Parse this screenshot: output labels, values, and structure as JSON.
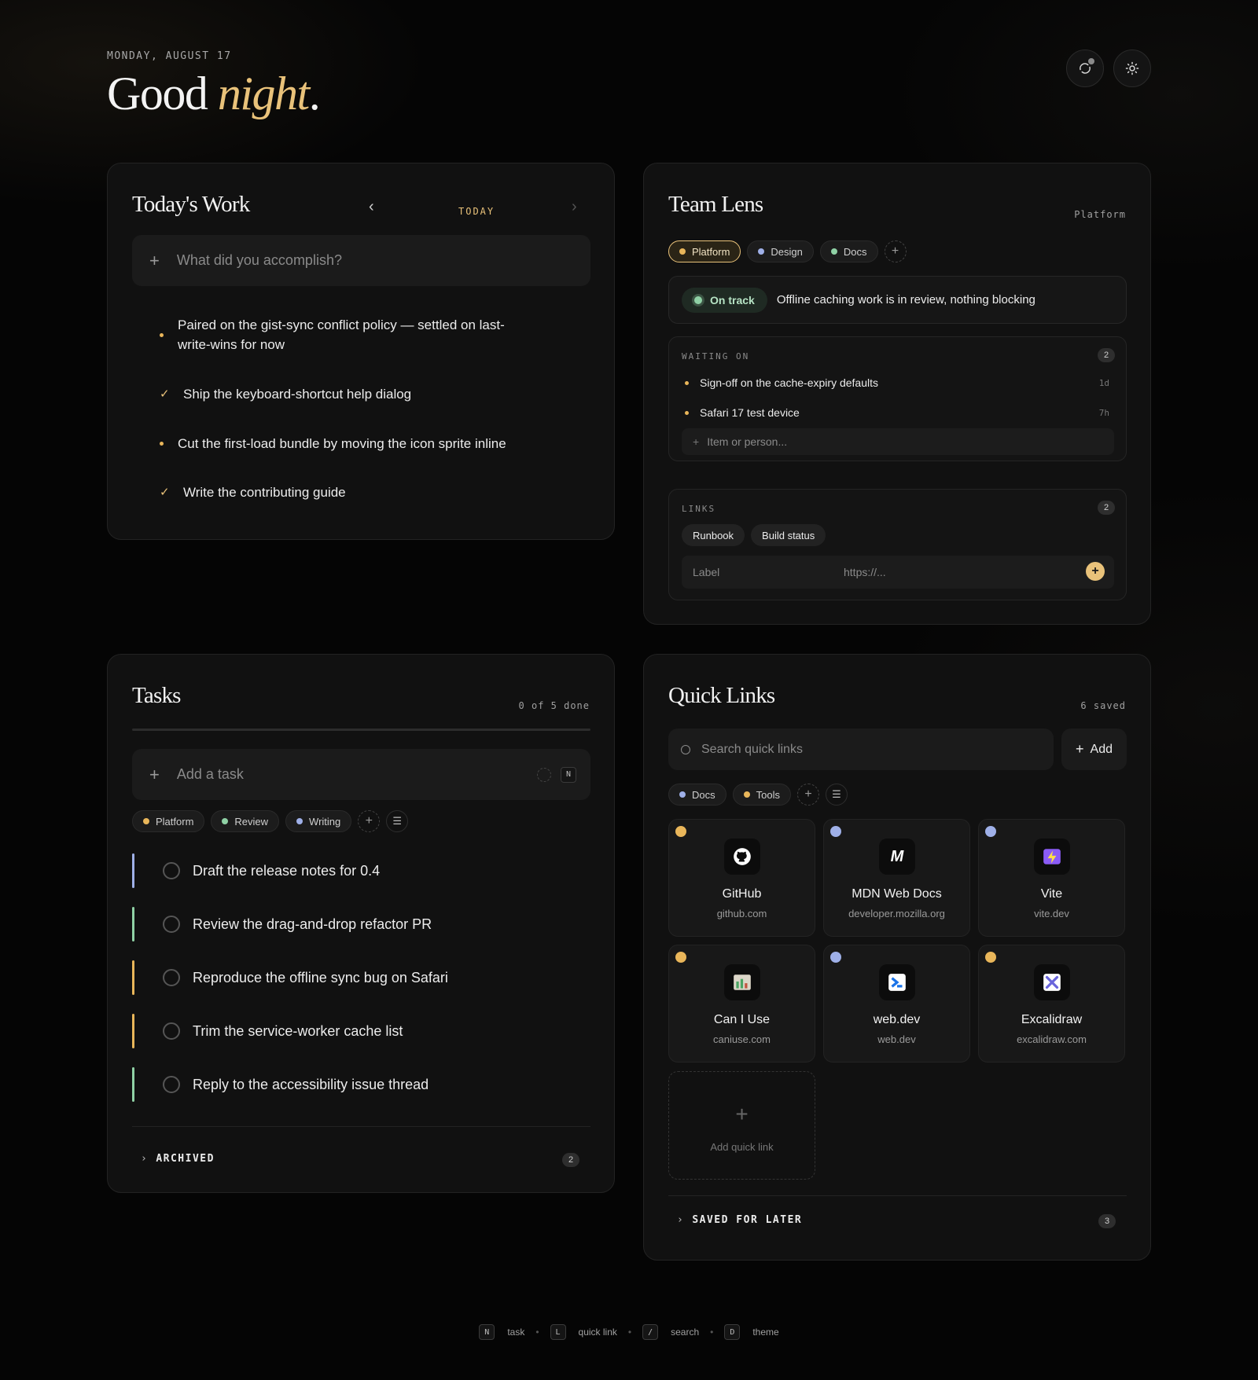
{
  "header": {
    "date": "MONDAY, AUGUST 17",
    "greeting_main": "Good",
    "greeting_accent": "night",
    "greeting_end": ".",
    "buttons": [
      {
        "icon": "sync-icon"
      },
      {
        "icon": "sun-icon"
      }
    ]
  },
  "today": {
    "title": "Today's Work",
    "nav_label": "TODAY",
    "placeholder": "What did you accomplish?",
    "items": [
      {
        "text": "Paired on the gist-sync conflict policy — settled on last-write-wins for now",
        "done": false
      },
      {
        "text": "Ship the keyboard-shortcut help dialog",
        "done": true
      },
      {
        "text": "Cut the first-load bundle by moving the icon sprite inline",
        "done": false
      },
      {
        "text": "Write the contributing guide",
        "done": true
      }
    ]
  },
  "team": {
    "title": "Team Lens",
    "meta": "Platform",
    "chips": [
      {
        "label": "Platform",
        "color": "#e9b65a",
        "active": true
      },
      {
        "label": "Design",
        "color": "#9fb0e8",
        "active": false
      },
      {
        "label": "Docs",
        "color": "#8fd1a5",
        "active": false
      }
    ],
    "status": {
      "pill": "On track",
      "text": "Offline caching work is in review, nothing blocking"
    },
    "waiting": {
      "label": "WAITING ON",
      "count": "2",
      "items": [
        {
          "text": "Sign-off on the cache-expiry defaults",
          "age": "1d"
        },
        {
          "text": "Safari 17 test device",
          "age": "7h"
        }
      ],
      "placeholder": "Item or person..."
    },
    "links": {
      "label": "LINKS",
      "count": "2",
      "items": [
        "Runbook",
        "Build status"
      ],
      "label_placeholder": "Label",
      "url_placeholder": "https://..."
    }
  },
  "tasks": {
    "title": "Tasks",
    "meta": "0 of 5 done",
    "progress": 0,
    "placeholder": "Add a task",
    "shortcut": "N",
    "filters": [
      {
        "label": "Platform",
        "color": "#e9b65a"
      },
      {
        "label": "Review",
        "color": "#8fd1a5"
      },
      {
        "label": "Writing",
        "color": "#9fb0e8"
      }
    ],
    "items": [
      {
        "text": "Draft the release notes for 0.4",
        "color": "#9fb0e8"
      },
      {
        "text": "Review the drag-and-drop refactor PR",
        "color": "#8fd1a5"
      },
      {
        "text": "Reproduce the offline sync bug on Safari",
        "color": "#e9b65a"
      },
      {
        "text": "Trim the service-worker cache list",
        "color": "#e9b65a"
      },
      {
        "text": "Reply to the accessibility issue thread",
        "color": "#8fd1a5"
      }
    ],
    "archived_label": "ARCHIVED",
    "archived_count": "2"
  },
  "quick": {
    "title": "Quick Links",
    "meta": "6 saved",
    "search_placeholder": "Search quick links",
    "add_label": "Add",
    "filters": [
      {
        "label": "Docs",
        "color": "#9fb0e8"
      },
      {
        "label": "Tools",
        "color": "#e9b65a"
      }
    ],
    "tiles": [
      {
        "name": "GitHub",
        "domain": "github.com",
        "color": "#e9b65a",
        "icon": "github-icon"
      },
      {
        "name": "MDN Web Docs",
        "domain": "developer.mozilla.org",
        "color": "#9fb0e8",
        "icon": "mdn-icon"
      },
      {
        "name": "Vite",
        "domain": "vite.dev",
        "color": "#9fb0e8",
        "icon": "vite-icon"
      },
      {
        "name": "Can I Use",
        "domain": "caniuse.com",
        "color": "#e9b65a",
        "icon": "caniuse-icon"
      },
      {
        "name": "web.dev",
        "domain": "web.dev",
        "color": "#9fb0e8",
        "icon": "webdev-icon"
      },
      {
        "name": "Excalidraw",
        "domain": "excalidraw.com",
        "color": "#e9b65a",
        "icon": "excalidraw-icon"
      }
    ],
    "add_tile_label": "Add quick link",
    "saved_label": "SAVED FOR LATER",
    "saved_count": "3"
  },
  "footer": {
    "shortcuts": [
      {
        "key": "N",
        "label": "task"
      },
      {
        "key": "L",
        "label": "quick link"
      },
      {
        "key": "/",
        "label": "search"
      },
      {
        "key": "D",
        "label": "theme"
      }
    ]
  }
}
